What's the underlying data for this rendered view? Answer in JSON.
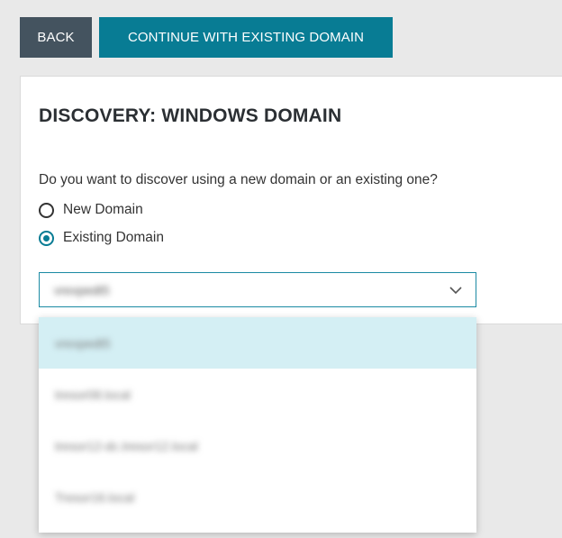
{
  "toolbar": {
    "back_label": "BACK",
    "continue_label": "CONTINUE WITH EXISTING DOMAIN"
  },
  "card": {
    "title": "DISCOVERY: WINDOWS DOMAIN",
    "question": "Do you want to discover using a new domain or an existing one?",
    "options": [
      {
        "label": "New Domain",
        "checked": false
      },
      {
        "label": "Existing Domain",
        "checked": true
      }
    ]
  },
  "domain_select": {
    "value": "vrexpedt5",
    "icon": "chevron-down-icon",
    "items": [
      {
        "label": "vrexpedt5",
        "selected": true
      },
      {
        "label": "tresor08.local",
        "selected": false
      },
      {
        "label": "tresor12-dc.tresor12.local",
        "selected": false
      },
      {
        "label": "Tresor16.local",
        "selected": false
      }
    ]
  },
  "colors": {
    "back_button": "#44535f",
    "primary": "#087c94",
    "selected_option": "#d4eff4",
    "background": "#e9e9e9"
  }
}
